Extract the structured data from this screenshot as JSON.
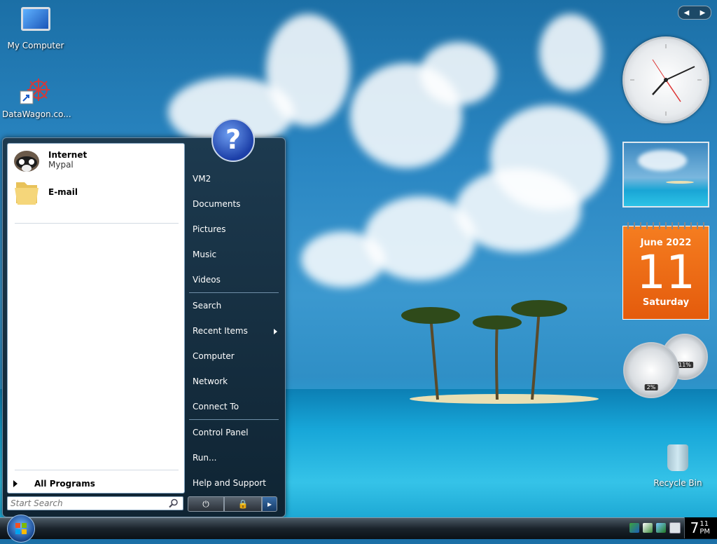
{
  "desktop": {
    "icons": [
      {
        "label": "My Computer",
        "icon": "computer-icon"
      },
      {
        "label": "DataWagon.co...",
        "icon": "datawagon-shortcut-icon"
      },
      {
        "label": "Recycle Bin",
        "icon": "recycle-bin-icon"
      }
    ]
  },
  "start_menu": {
    "pinned": [
      {
        "title": "Internet",
        "subtitle": "Mypal",
        "icon": "mypal-raccoon-icon"
      },
      {
        "title": "E-mail",
        "subtitle": "",
        "icon": "folder-icon"
      }
    ],
    "all_programs": "All Programs",
    "search_placeholder": "Start Search",
    "right_items": [
      {
        "label": "VM2"
      },
      {
        "label": "Documents"
      },
      {
        "label": "Pictures"
      },
      {
        "label": "Music"
      },
      {
        "label": "Videos"
      },
      {
        "label": "Search"
      },
      {
        "label": "Recent Items"
      },
      {
        "label": "Computer"
      },
      {
        "label": "Network"
      },
      {
        "label": "Connect To"
      },
      {
        "label": "Control Panel"
      },
      {
        "label": "Run..."
      },
      {
        "label": "Help and Support"
      }
    ],
    "help_glyph": "?"
  },
  "gadgets": {
    "calendar": {
      "month": "June 2022",
      "day": "11",
      "weekday": "Saturday"
    },
    "cpu_meter": {
      "cpu": "2%",
      "memory": "11%"
    }
  },
  "taskbar": {
    "clock_hour": "7",
    "clock_minute": "11",
    "clock_ampm": "PM"
  },
  "colors": {
    "calendar_orange": "#f26f1a",
    "menu_dark": "#132a3a",
    "taskbar_dark": "#1a232b"
  }
}
